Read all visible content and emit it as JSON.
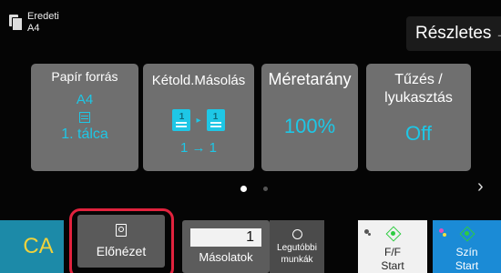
{
  "original": {
    "label": "Eredeti",
    "size": "A4"
  },
  "details_button": {
    "label": "Részletes",
    "arrow": "→"
  },
  "tiles": {
    "paper_source": {
      "title": "Papír forrás",
      "size": "A4",
      "tray": "1. tálca"
    },
    "duplex": {
      "title": "Kétold.Másolás",
      "value": "1 → 1",
      "page_a": "1",
      "page_b": "1"
    },
    "ratio": {
      "title": "Méretarány",
      "value": "100%"
    },
    "staple": {
      "title": "Tűzés / lyukasztás",
      "value": "Off"
    }
  },
  "pager": {
    "next": "›"
  },
  "bottom": {
    "clear_all": "CA",
    "preview": "Előnézet",
    "copies_label": "Másolatok",
    "copies_value": "1",
    "recent_jobs": "Legutóbbi munkák",
    "bw_start": {
      "line1": "F/F",
      "line2": "Start"
    },
    "color_start": {
      "line1": "Szín",
      "line2": "Start"
    }
  },
  "colors": {
    "accent": "#1ec7e6",
    "highlight": "#e1223d",
    "color_start_bg": "#1b8bd6",
    "ca_bg": "#1c8aa8"
  }
}
